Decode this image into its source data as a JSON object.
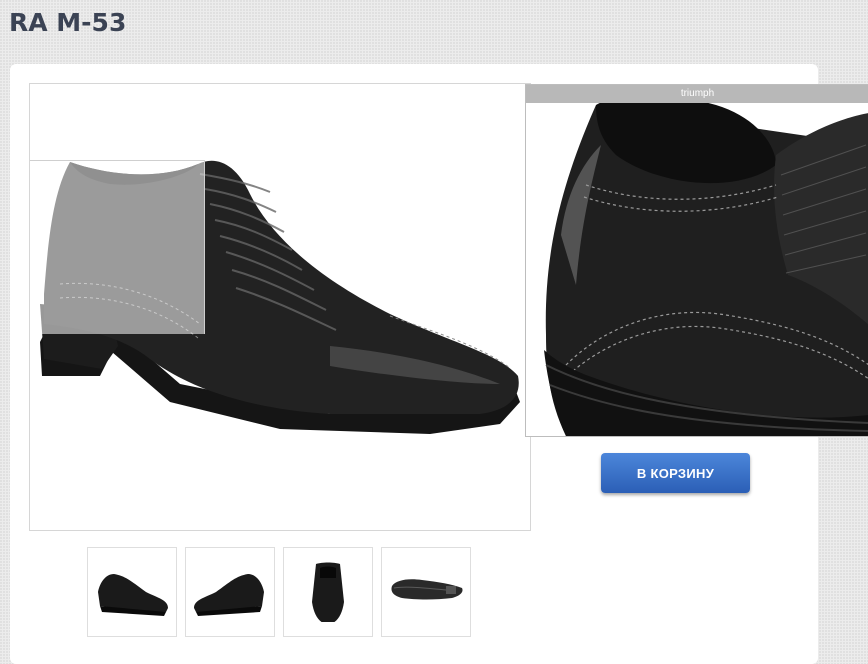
{
  "product": {
    "title": "RA M-53"
  },
  "zoom": {
    "caption": "triumph"
  },
  "cart_button": {
    "label": "В КОРЗИНУ",
    "color": "#3a72c9"
  },
  "thumbnails": [
    {
      "view": "side-left"
    },
    {
      "view": "side-right"
    },
    {
      "view": "front"
    },
    {
      "view": "sole"
    }
  ]
}
